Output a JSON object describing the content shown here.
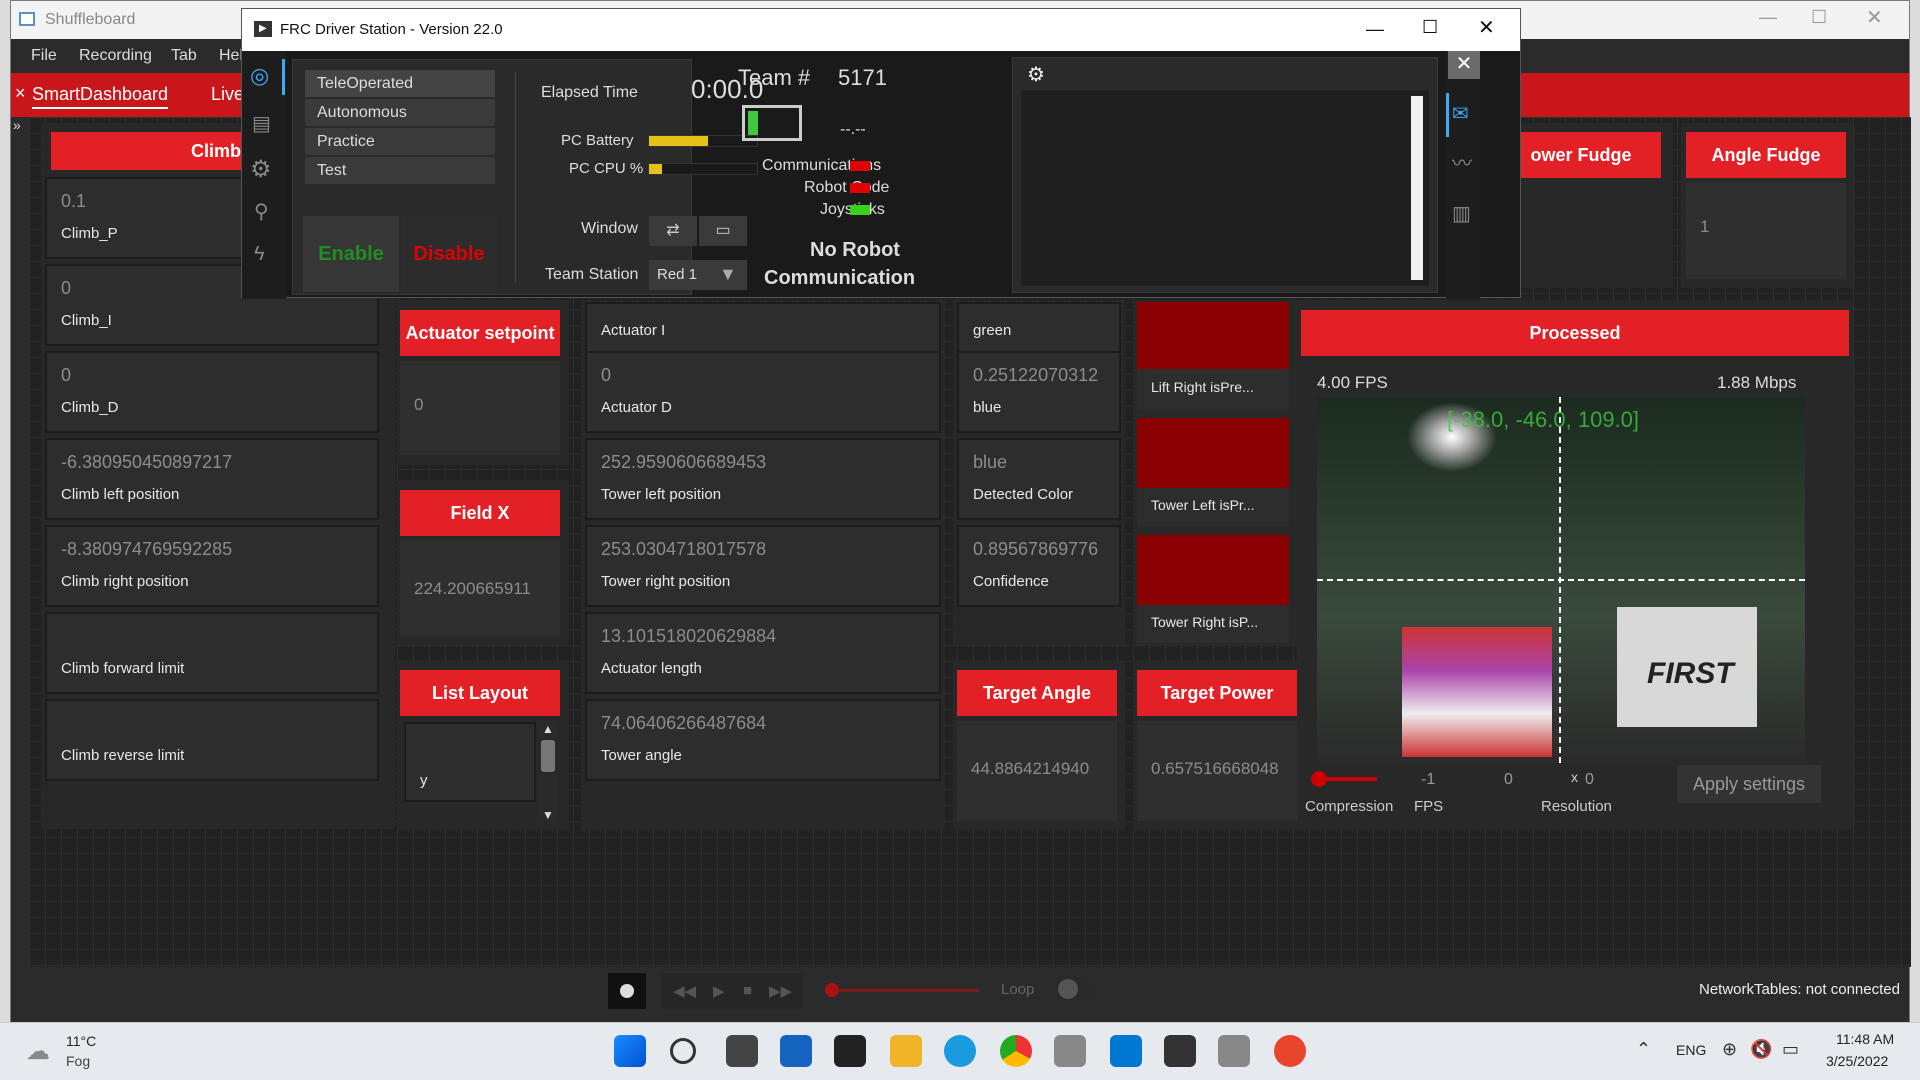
{
  "shuffleboard": {
    "title": "Shuffleboard",
    "menu": [
      "File",
      "Recording",
      "Tab",
      "Hel"
    ],
    "tabs": [
      "SmartDashboard",
      "Live"
    ],
    "bottom": {
      "loop_label": "Loop",
      "nt_status": "NetworkTables: not connected"
    }
  },
  "widgets": {
    "climb_title": "Climb",
    "climb_rows": [
      {
        "value": "0.1",
        "label": "Climb_P"
      },
      {
        "value": "0",
        "label": "Climb_I"
      },
      {
        "value": "0",
        "label": "Climb_D"
      },
      {
        "value": "-6.380950450897217",
        "label": "Climb left position"
      },
      {
        "value": "-8.380974769592285",
        "label": "Climb right position"
      },
      {
        "value": "",
        "label": "Climb forward limit"
      },
      {
        "value": "",
        "label": "Climb reverse limit"
      }
    ],
    "actuator_setpoint": {
      "title": "Actuator setpoint",
      "value": "0"
    },
    "field_x": {
      "title": "Field X",
      "value": "224.200665911"
    },
    "list_layout": {
      "title": "List Layout",
      "item": "y"
    },
    "col3_rows": [
      {
        "value": "",
        "label": "Actuator I"
      },
      {
        "value": "0",
        "label": "Actuator D"
      },
      {
        "value": "252.9590606689453",
        "label": "Tower left position"
      },
      {
        "value": "253.0304718017578",
        "label": "Tower right position"
      },
      {
        "value": "13.101518020629884",
        "label": "Actuator length"
      },
      {
        "value": "74.06406266487684",
        "label": "Tower angle"
      }
    ],
    "col4_rows": [
      {
        "value": "",
        "label": "green"
      },
      {
        "value": "0.25122070312",
        "label": "blue"
      },
      {
        "value": "blue",
        "label": "Detected Color"
      },
      {
        "value": "0.89567869776",
        "label": "Confidence"
      }
    ],
    "bool_tiles": [
      "Lift Right isPre...",
      "Tower Left isPr...",
      "Tower Right isP..."
    ],
    "target_angle": {
      "title": "Target Angle",
      "value": "44.8864214940"
    },
    "target_power": {
      "title": "Target Power",
      "value": "0.657516668048"
    },
    "tower_fudge": {
      "title": "ower Fudge"
    },
    "angle_fudge": {
      "title": "Angle Fudge",
      "value": "1"
    },
    "processed": {
      "title": "Processed",
      "fps": "4.00 FPS",
      "mbps": "1.88 Mbps",
      "overlay": "[-38.0, -46.0, 109.0]",
      "compression_label": "Compression",
      "fps_value": "-1",
      "fps_label": "FPS",
      "res_w": "0",
      "res_x": "x",
      "res_h": "0",
      "res_label": "Resolution",
      "apply": "Apply settings"
    }
  },
  "driver_station": {
    "title": "FRC Driver Station - Version 22.0",
    "modes": [
      "TeleOperated",
      "Autonomous",
      "Practice",
      "Test"
    ],
    "enable": "Enable",
    "disable": "Disable",
    "elapsed_label": "Elapsed Time",
    "elapsed_value": "0:00.0",
    "pc_battery_label": "PC Battery",
    "pc_battery_level": 0.55,
    "pc_cpu_label": "PC CPU %",
    "pc_cpu_level": 0.12,
    "window_label": "Window",
    "team_station_label": "Team Station",
    "team_station_value": "Red 1",
    "team_label": "Team #",
    "team_number": "5171",
    "voltage": "--.--",
    "comms_label": "Communications",
    "robot_code_label": "Robot Code",
    "joysticks_label": "Joysticks",
    "status_line1": "No Robot",
    "status_line2": "Communication",
    "colors": {
      "red": "#e00000",
      "green": "#39d11a",
      "accent": "#e32026"
    }
  },
  "taskbar": {
    "temp": "11°C",
    "weather": "Fog",
    "lang": "ENG",
    "time": "11:48 AM",
    "date": "3/25/2022"
  }
}
